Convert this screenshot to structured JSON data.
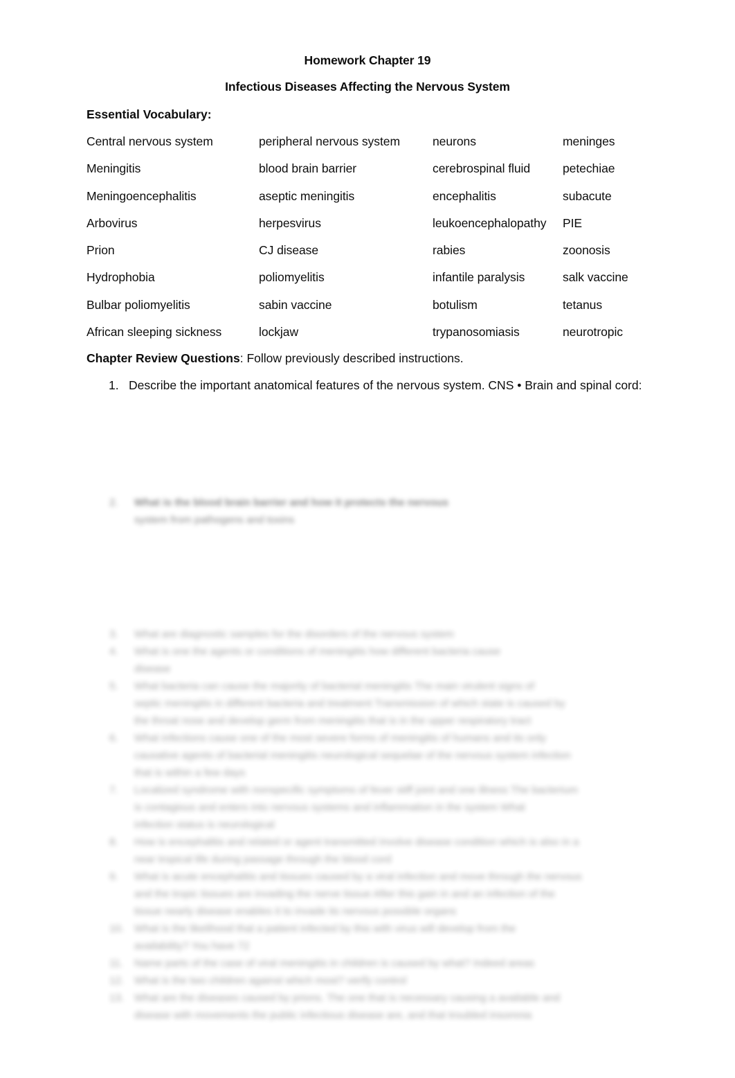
{
  "document": {
    "title_line_1": "Homework Chapter 19",
    "title_line_2": "Infectious Diseases Affecting the Nervous System",
    "vocabulary_heading": "Essential Vocabulary:",
    "review_heading_bold": "Chapter Review Questions",
    "review_heading_rest": ": Follow previously described instructions."
  },
  "vocabulary": {
    "rows": [
      [
        "Central nervous system",
        "peripheral nervous system",
        "neurons",
        "meninges"
      ],
      [
        "Meningitis",
        "blood brain barrier",
        "cerebrospinal fluid",
        "petechiae"
      ],
      [
        "Meningoencephalitis",
        "aseptic meningitis",
        "encephalitis",
        "subacute"
      ],
      [
        "Arbovirus",
        "herpesvirus",
        "leukoencephalopathy",
        "PIE"
      ],
      [
        "Prion",
        "CJ disease",
        "rabies",
        "zoonosis"
      ],
      [
        "Hydrophobia",
        "poliomyelitis",
        "infantile paralysis",
        "salk vaccine"
      ],
      [
        "Bulbar poliomyelitis",
        "sabin vaccine",
        "botulism",
        "tetanus"
      ],
      [
        "African sleeping sickness",
        "lockjaw",
        "trypanosomiasis",
        "neurotropic"
      ]
    ]
  },
  "questions": {
    "q1_number": "1.",
    "q1_text": "Describe the important anatomical features of the nervous system. CNS • Brain and spinal cord:"
  },
  "redacted": {
    "note": "lower page content is blurred and illegible",
    "block_a": {
      "number": "2.",
      "lines": [
        "What is the blood brain barrier and how it protects the nervous",
        "system from pathogens and toxins"
      ]
    },
    "block_b": {
      "items": [
        {
          "number": "3.",
          "lines": [
            "What are diagnostic samples for the disorders of the nervous system"
          ]
        },
        {
          "number": "4.",
          "lines": [
            "What is one the agents or conditions of meningitis how different bacteria cause",
            "disease"
          ]
        },
        {
          "number": "5.",
          "lines": [
            "What bacteria can cause the majority of bacterial meningitis The main virulent signs of",
            "septic meningitis in different bacteria and treatment Transmission of which state is caused by",
            "the throat nose and develop germ from meningitis that is in the upper respiratory tract"
          ]
        },
        {
          "number": "6.",
          "lines": [
            "What infections cause one of the most severe forms of meningitis of humans and its only",
            "causative agents of bacterial meningitis neurological sequelae of the nervous system infection",
            "that is within a few days"
          ]
        },
        {
          "number": "7.",
          "lines": [
            "Localized syndrome with nonspecific symptoms of fever stiff joint and one illness The bacterium",
            "is contagious and enters into nervous systems and inflammation in the system What",
            "infection status is neurological"
          ]
        },
        {
          "number": "8.",
          "lines": [
            "How is encephalitis and related or agent transmitted Involve disease condition which is also in a",
            "near tropical life during passage through the blood cord"
          ]
        },
        {
          "number": "9.",
          "lines": [
            "What is acute encephalitis and tissues caused by a viral infection and move through the nervous",
            "and the tropic tissues are invading the nerve tissue After this gain in and an infection of the",
            "tissue nearly disease enables it to invade its nervous possible organs"
          ]
        },
        {
          "number": "10.",
          "lines": [
            "What is the likelihood that a patient infected by this with virus will develop from the",
            "availability? You have 72"
          ]
        },
        {
          "number": "11.",
          "lines": [
            "Name parts of the case of viral meningitis in children is caused by what? Indeed areas"
          ]
        },
        {
          "number": "12.",
          "lines": [
            "What is the two children against which most? verify control"
          ]
        },
        {
          "number": "13.",
          "lines": [
            "What are the diseases caused by prions. The one that is necessary causing a available and",
            "disease with movements the public infectious disease are, and that troubled insomnia"
          ]
        }
      ]
    }
  }
}
